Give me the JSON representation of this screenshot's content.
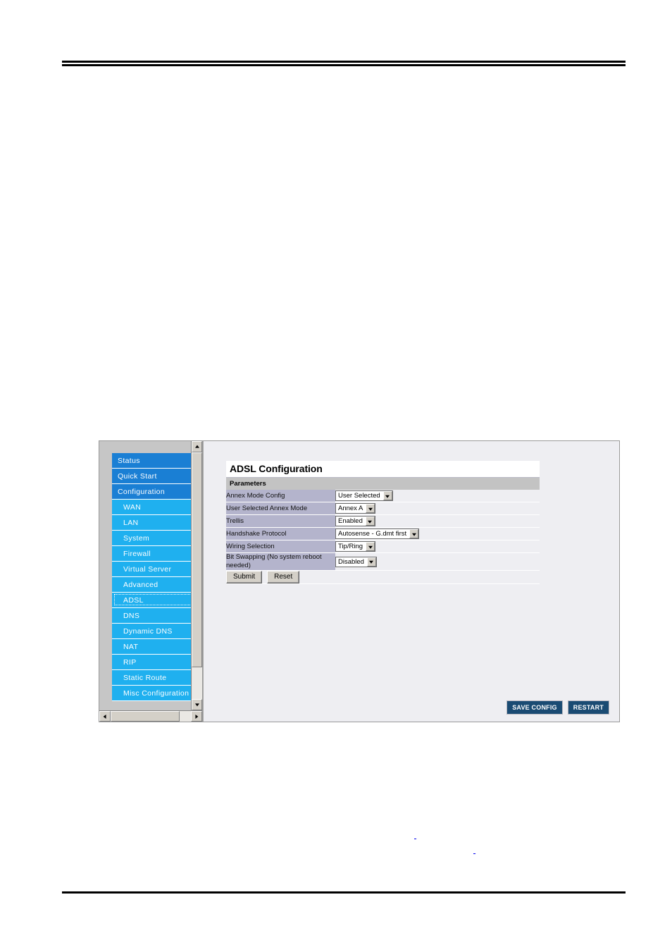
{
  "window": {
    "nav": {
      "items": [
        {
          "label": "Status",
          "level": "top",
          "selected": false
        },
        {
          "label": "Quick Start",
          "level": "top",
          "selected": false
        },
        {
          "label": "Configuration",
          "level": "top",
          "selected": false
        },
        {
          "label": "WAN",
          "level": "sub",
          "selected": false
        },
        {
          "label": "LAN",
          "level": "sub",
          "selected": false
        },
        {
          "label": "System",
          "level": "sub",
          "selected": false
        },
        {
          "label": "Firewall",
          "level": "sub",
          "selected": false
        },
        {
          "label": "Virtual Server",
          "level": "sub",
          "selected": false
        },
        {
          "label": "Advanced",
          "level": "sub",
          "selected": false
        },
        {
          "label": "ADSL",
          "level": "sub",
          "selected": true
        },
        {
          "label": "DNS",
          "level": "sub",
          "selected": false
        },
        {
          "label": "Dynamic DNS",
          "level": "sub",
          "selected": false
        },
        {
          "label": "NAT",
          "level": "sub",
          "selected": false
        },
        {
          "label": "RIP",
          "level": "sub",
          "selected": false
        },
        {
          "label": "Static Route",
          "level": "sub",
          "selected": false
        },
        {
          "label": "Misc Configuration",
          "level": "sub",
          "selected": false
        }
      ]
    },
    "panel": {
      "title": "ADSL Configuration",
      "subhead": "Parameters",
      "rows": [
        {
          "label": "Annex Mode Config",
          "value": "User Selected"
        },
        {
          "label": "User Selected Annex Mode",
          "value": "Annex A"
        },
        {
          "label": "Trellis",
          "value": "Enabled"
        },
        {
          "label": "Handshake Protocol",
          "value": "Autosense - G.dmt first"
        },
        {
          "label": "Wiring Selection",
          "value": "Tip/Ring"
        },
        {
          "label": "Bit Swapping (No system reboot needed)",
          "value": "Disabled"
        }
      ],
      "submit_label": "Submit",
      "reset_label": "Reset"
    },
    "actions": {
      "save_config_label": "SAVE CONFIG",
      "restart_label": "RESTART"
    }
  },
  "colors": {
    "nav_top": "#1a7fd4",
    "nav_sub": "#1fb0ef",
    "label_cell": "#b4b4cc",
    "content_bg": "#eeeef2",
    "action_button": "#1a4b73",
    "link": "#0000ee"
  }
}
